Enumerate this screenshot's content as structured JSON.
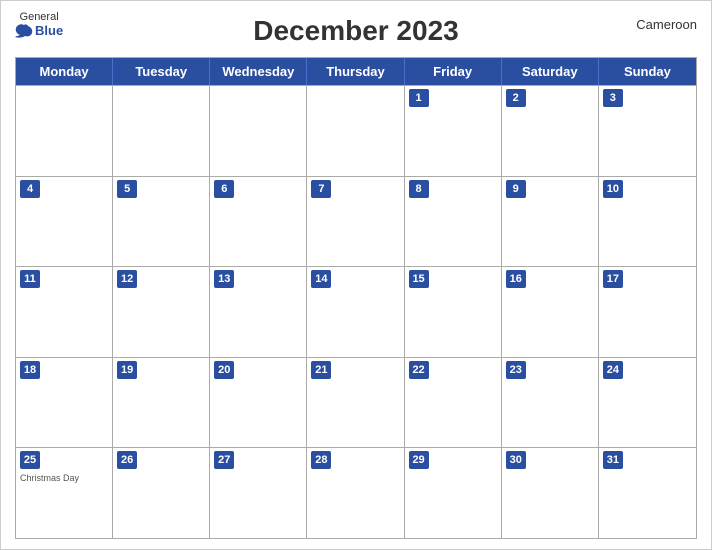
{
  "header": {
    "title": "December 2023",
    "country": "Cameroon"
  },
  "logo": {
    "general": "General",
    "blue": "Blue"
  },
  "dayHeaders": [
    "Monday",
    "Tuesday",
    "Wednesday",
    "Thursday",
    "Friday",
    "Saturday",
    "Sunday"
  ],
  "weeks": [
    [
      {
        "num": "",
        "empty": true,
        "holiday": ""
      },
      {
        "num": "",
        "empty": true,
        "holiday": ""
      },
      {
        "num": "",
        "empty": true,
        "holiday": ""
      },
      {
        "num": "",
        "empty": true,
        "holiday": ""
      },
      {
        "num": "1",
        "empty": false,
        "holiday": ""
      },
      {
        "num": "2",
        "empty": false,
        "holiday": ""
      },
      {
        "num": "3",
        "empty": false,
        "holiday": ""
      }
    ],
    [
      {
        "num": "4",
        "empty": false,
        "holiday": ""
      },
      {
        "num": "5",
        "empty": false,
        "holiday": ""
      },
      {
        "num": "6",
        "empty": false,
        "holiday": ""
      },
      {
        "num": "7",
        "empty": false,
        "holiday": ""
      },
      {
        "num": "8",
        "empty": false,
        "holiday": ""
      },
      {
        "num": "9",
        "empty": false,
        "holiday": ""
      },
      {
        "num": "10",
        "empty": false,
        "holiday": ""
      }
    ],
    [
      {
        "num": "11",
        "empty": false,
        "holiday": ""
      },
      {
        "num": "12",
        "empty": false,
        "holiday": ""
      },
      {
        "num": "13",
        "empty": false,
        "holiday": ""
      },
      {
        "num": "14",
        "empty": false,
        "holiday": ""
      },
      {
        "num": "15",
        "empty": false,
        "holiday": ""
      },
      {
        "num": "16",
        "empty": false,
        "holiday": ""
      },
      {
        "num": "17",
        "empty": false,
        "holiday": ""
      }
    ],
    [
      {
        "num": "18",
        "empty": false,
        "holiday": ""
      },
      {
        "num": "19",
        "empty": false,
        "holiday": ""
      },
      {
        "num": "20",
        "empty": false,
        "holiday": ""
      },
      {
        "num": "21",
        "empty": false,
        "holiday": ""
      },
      {
        "num": "22",
        "empty": false,
        "holiday": ""
      },
      {
        "num": "23",
        "empty": false,
        "holiday": ""
      },
      {
        "num": "24",
        "empty": false,
        "holiday": ""
      }
    ],
    [
      {
        "num": "25",
        "empty": false,
        "holiday": "Christmas Day"
      },
      {
        "num": "26",
        "empty": false,
        "holiday": ""
      },
      {
        "num": "27",
        "empty": false,
        "holiday": ""
      },
      {
        "num": "28",
        "empty": false,
        "holiday": ""
      },
      {
        "num": "29",
        "empty": false,
        "holiday": ""
      },
      {
        "num": "30",
        "empty": false,
        "holiday": ""
      },
      {
        "num": "31",
        "empty": false,
        "holiday": ""
      }
    ]
  ]
}
